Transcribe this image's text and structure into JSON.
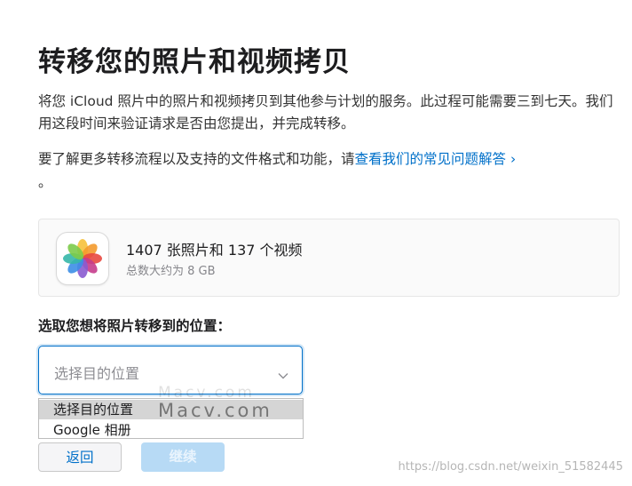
{
  "header": {
    "title": "转移您的照片和视频拷贝"
  },
  "intro": {
    "description": "将您 iCloud 照片中的照片和视频拷贝到其他参与计划的服务。此过程可能需要三到七天。我们用这段时间来验证请求是否由您提出，并完成转移。",
    "more_prefix": "要了解更多转移流程以及支持的文件格式和功能，请",
    "more_link": "查看我们的常见问题解答 ›",
    "more_suffix": "。"
  },
  "library": {
    "icon": "photos-app-icon",
    "counts": "1407 张照片和 137 个视频",
    "size": "总数大约为 8 GB"
  },
  "destination": {
    "prompt": "选取您想将照片转移到的位置：",
    "placeholder": "选择目的位置",
    "options": [
      "选择目的位置",
      "Google 相册"
    ],
    "selected_index": 0
  },
  "actions": {
    "back_label": "返回",
    "continue_label": "继续"
  },
  "watermarks": {
    "ghost": "Macv.com",
    "main": "Macv.com",
    "csdn": "https://blog.csdn.net/weixin_51582445"
  },
  "colors": {
    "accent": "#0070c9",
    "disabled_button": "#b7daf5",
    "focus_border": "#0070c9",
    "option_highlight": "#d5d5d5"
  }
}
